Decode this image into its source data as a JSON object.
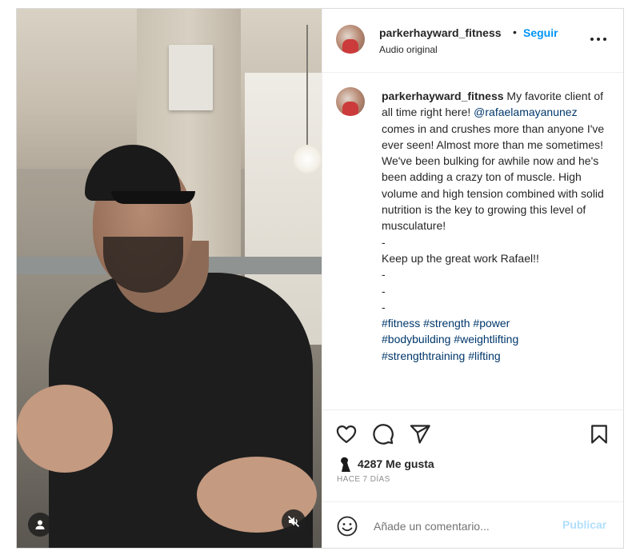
{
  "header": {
    "username": "parkerhayward_fitness",
    "dot": "•",
    "follow_label": "Seguir",
    "audio_label": "Audio original",
    "more_icon": "more-horizontal-icon"
  },
  "caption": {
    "username": "parkerhayward_fitness",
    "text_1": " My favorite client of all time right here! ",
    "mention": "@rafaelamayanunez",
    "text_2": " comes in and crushes more than anyone I've ever seen! Almost more than me sometimes!\nWe've been bulking for awhile now and he's been adding a crazy ton of muscle. High volume and high tension combined with solid nutrition is the key to growing this level of musculature!\n-\nKeep up the great work Rafael!!\n-\n-\n-\n",
    "hashtags": [
      "#fitness",
      "#strength",
      "#power",
      "#bodybuilding",
      "#weightlifting",
      "#strengthtraining",
      "#lifting"
    ]
  },
  "actions": {
    "like_icon": "heart-icon",
    "comment_icon": "comment-icon",
    "share_icon": "send-icon",
    "save_icon": "bookmark-icon"
  },
  "likes": {
    "count_text": "4287 Me gusta"
  },
  "date_text": "HACE 7 DÍAS",
  "comment_box": {
    "placeholder": "Añade un comentario...",
    "publish_label": "Publicar"
  },
  "colors": {
    "accent": "#0095f6",
    "publish_disabled": "#b2dffc",
    "link": "#00376b"
  }
}
